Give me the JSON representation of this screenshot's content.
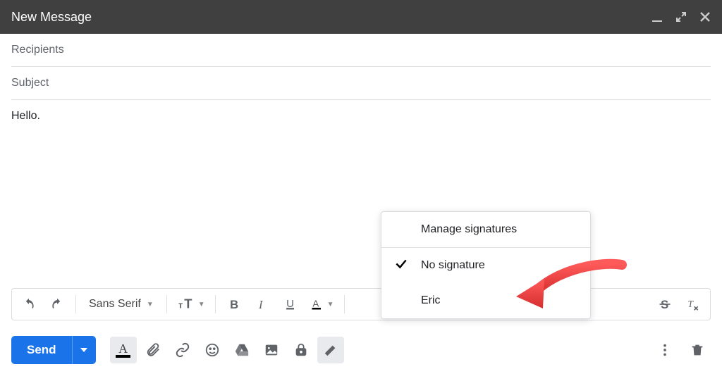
{
  "header": {
    "title": "New Message"
  },
  "fields": {
    "recipients_placeholder": "Recipients",
    "subject_placeholder": "Subject"
  },
  "body": {
    "content": "Hello."
  },
  "format_toolbar": {
    "font": "Sans Serif"
  },
  "actions": {
    "send_label": "Send"
  },
  "signature_menu": {
    "manage": "Manage signatures",
    "items": [
      {
        "label": "No signature",
        "selected": true
      },
      {
        "label": "Eric",
        "selected": false
      }
    ]
  }
}
